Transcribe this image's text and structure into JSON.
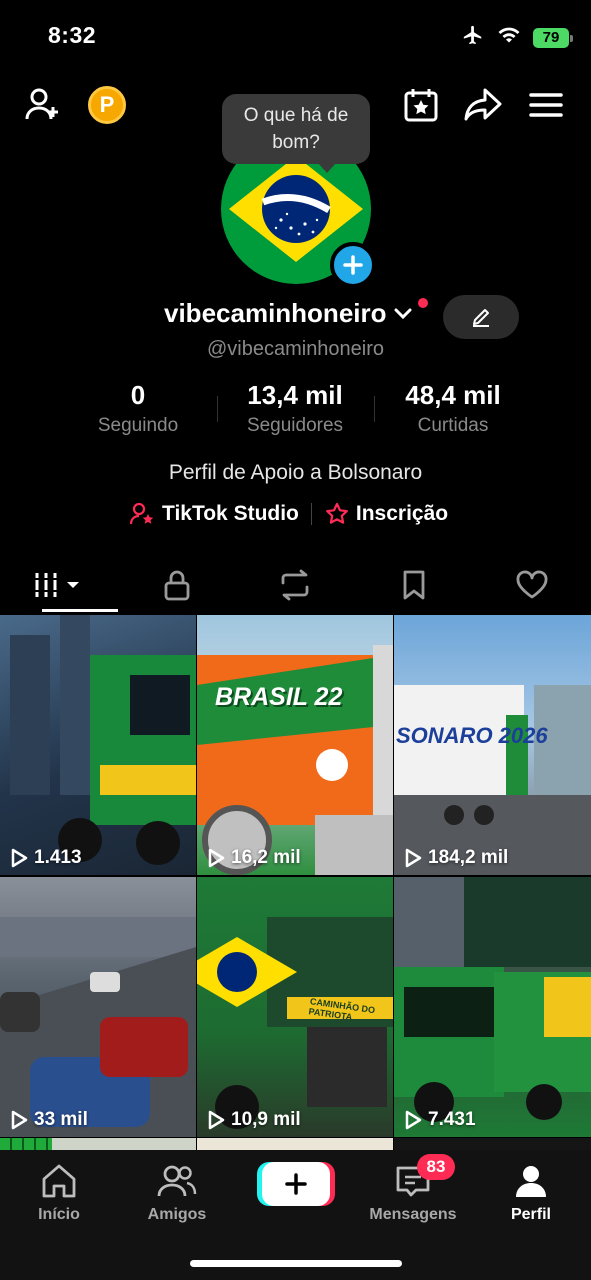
{
  "status_bar": {
    "time": "8:32",
    "battery": "79"
  },
  "top_bar": {
    "coin_label": "P",
    "tooltip_line1": "O que há de",
    "tooltip_line2": "bom?"
  },
  "profile": {
    "username": "vibecaminhoneiro",
    "handle": "@vibecaminhoneiro",
    "stats": [
      {
        "value": "0",
        "label": "Seguindo"
      },
      {
        "value": "13,4 mil",
        "label": "Seguidores"
      },
      {
        "value": "48,4 mil",
        "label": "Curtidas"
      }
    ],
    "bio": "Perfil de Apoio a Bolsonaro",
    "links": [
      {
        "label": "TikTok Studio",
        "icon": "user-star-icon"
      },
      {
        "label": "Inscrição",
        "icon": "star-badge-icon"
      }
    ]
  },
  "tabs": [
    "videos-grid",
    "private",
    "reposts",
    "favorites",
    "liked"
  ],
  "videos": [
    {
      "views": "1.413",
      "caption": ""
    },
    {
      "views": "16,2 mil",
      "caption": "BRASIL 22"
    },
    {
      "views": "184,2 mil",
      "caption": "SONARO 2026"
    },
    {
      "views": "33 mil",
      "caption": ""
    },
    {
      "views": "10,9 mil",
      "caption": "CAMINHÃO DO PATRIOTA"
    },
    {
      "views": "7.431",
      "caption": ""
    }
  ],
  "bottom_nav": {
    "home": "Início",
    "friends": "Amigos",
    "messages": "Mensagens",
    "messages_badge": "83",
    "profile": "Perfil"
  },
  "colors": {
    "accent_red": "#fe2c55",
    "accent_cyan": "#25f4ee",
    "plus_blue": "#21a6e8",
    "flag_green": "#009c3b",
    "flag_yellow": "#ffdf00",
    "flag_blue": "#002776"
  }
}
